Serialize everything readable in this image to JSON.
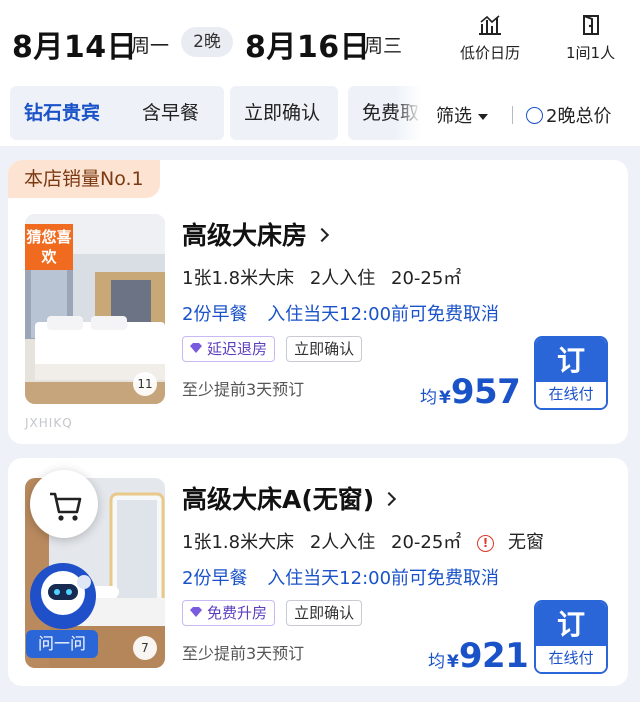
{
  "dates": {
    "checkin_date": "8月14日",
    "checkin_weekday": "周一",
    "nights": "2晚",
    "checkout_date": "8月16日",
    "checkout_weekday": "周三"
  },
  "tools": {
    "calendar_label": "低价日历",
    "rooms_guests_label": "1间1人"
  },
  "filters": {
    "chips": [
      "钻石贵宾",
      "含早餐",
      "立即确认",
      "免费取"
    ],
    "filter_label": "筛选",
    "total_price_label": "2晚总价"
  },
  "rooms": [
    {
      "badge": "本店销量No.1",
      "photo_tag": "猜您喜欢",
      "photo_count": "11",
      "watermark": "JXHIKQ",
      "name": "高级大床房",
      "bed": "1张1.8米大床",
      "guests": "2人入住",
      "area": "20-25㎡",
      "breakfast": "2份早餐",
      "cancel": "入住当天12:00前可免费取消",
      "tags": [
        "延迟退房",
        "立即确认"
      ],
      "advance": "至少提前3天预订",
      "price_prefix": "均",
      "currency": "¥",
      "price": "957",
      "book_label": "订",
      "pay_label": "在线付"
    },
    {
      "photo_count": "7",
      "name": "高级大床A(无窗)",
      "bed": "1张1.8米大床",
      "guests": "2人入住",
      "area": "20-25㎡",
      "window_note": "无窗",
      "breakfast": "2份早餐",
      "cancel": "入住当天12:00前可免费取消",
      "tags": [
        "免费升房",
        "立即确认"
      ],
      "advance": "至少提前3天预订",
      "price_prefix": "均",
      "currency": "¥",
      "price": "921",
      "book_label": "订",
      "pay_label": "在线付"
    }
  ],
  "assistant": {
    "ask_label": "问一问",
    "cart_icon": "cart-icon"
  },
  "colors": {
    "accent": "#1a52c8",
    "book_button": "#2a66d8",
    "badge_bg": "#fde3d2",
    "tag_orange": "#f06a1f"
  }
}
